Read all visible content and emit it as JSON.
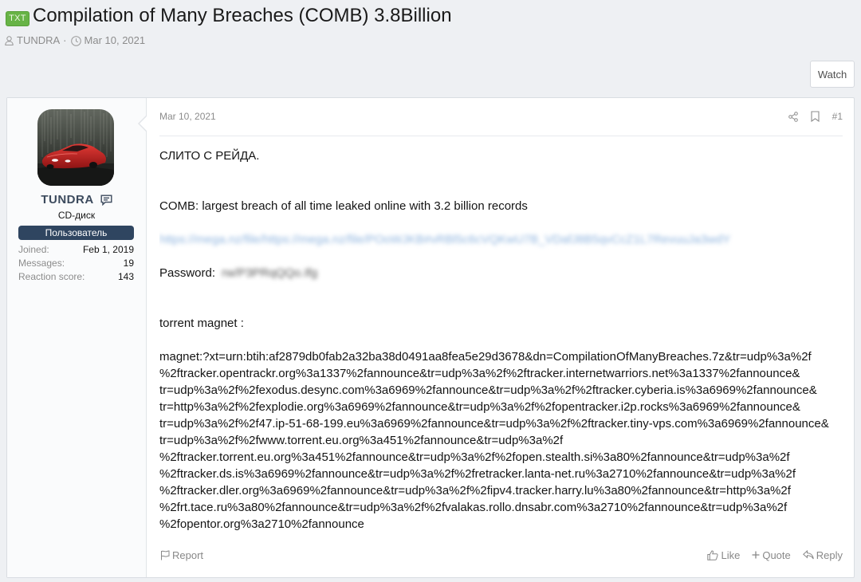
{
  "thread": {
    "prefix": "TXT",
    "title": "Compilation of Many Breaches (COMB) 3.8Billion",
    "author": "TUNDRA",
    "separator": "·",
    "date": "Mar 10, 2021",
    "watch_label": "Watch"
  },
  "user": {
    "name": "TUNDRA",
    "title": "CD-диск",
    "banner": "Пользователь",
    "stats": [
      {
        "label": "Joined:",
        "value": "Feb 1, 2019"
      },
      {
        "label": "Messages:",
        "value": "19"
      },
      {
        "label": "Reaction score:",
        "value": "143"
      }
    ]
  },
  "post": {
    "date": "Mar 10, 2021",
    "number": "#1",
    "body": {
      "line1": "СЛИТО С РЕЙДА.",
      "line2": "COMB: largest breach of all time leaked online with 3.2 billion records",
      "link_blurred": "https://mega.nz/file/https://mega.nz/file/POoWJKB#vRBl5c6cVQKwU7B_VDafJ8B5qvCcZ1L7RevuuJa3wdY",
      "password_label": "Password:",
      "password_blurred": "rw/P3PRqQQo.Ifg",
      "magnet_label": "torrent magnet :",
      "magnet_lines": [
        "magnet:?xt=urn:btih:af2879db0fab2a32ba38d0491aa8fea5e29d3678&dn=CompilationOfManyBreaches.7z&tr=udp%3a%2f",
        "%2ftracker.opentrackr.org%3a1337%2fannounce&tr=udp%3a%2f%2ftracker.internetwarriors.net%3a1337%2fannounce&",
        "tr=udp%3a%2f%2fexodus.desync.com%3a6969%2fannounce&tr=udp%3a%2f%2ftracker.cyberia.is%3a6969%2fannounce&",
        "tr=http%3a%2f%2fexplodie.org%3a6969%2fannounce&tr=udp%3a%2f%2fopentracker.i2p.rocks%3a6969%2fannounce&",
        "tr=udp%3a%2f%2f47.ip-51-68-199.eu%3a6969%2fannounce&tr=udp%3a%2f%2ftracker.tiny-vps.com%3a6969%2fannounce&",
        "tr=udp%3a%2f%2fwww.torrent.eu.org%3a451%2fannounce&tr=udp%3a%2f",
        "%2ftracker.torrent.eu.org%3a451%2fannounce&tr=udp%3a%2f%2fopen.stealth.si%3a80%2fannounce&tr=udp%3a%2f",
        "%2ftracker.ds.is%3a6969%2fannounce&tr=udp%3a%2f%2fretracker.lanta-net.ru%3a2710%2fannounce&tr=udp%3a%2f",
        "%2ftracker.dler.org%3a6969%2fannounce&tr=udp%3a%2f%2fipv4.tracker.harry.lu%3a80%2fannounce&tr=http%3a%2f",
        "%2frt.tace.ru%3a80%2fannounce&tr=udp%3a%2f%2fvalakas.rollo.dnsabr.com%3a2710%2fannounce&tr=udp%3a%2f",
        "%2fopentor.org%3a2710%2fannounce"
      ]
    },
    "actions": {
      "report": "Report",
      "like": "Like",
      "quote": "Quote",
      "reply": "Reply"
    }
  },
  "icons": {
    "author": "user-icon",
    "date": "clock-icon",
    "username_badge": "message-icon",
    "share": "share-icon",
    "bookmark": "bookmark-icon",
    "report": "flag-icon",
    "like": "thumbs-up-icon",
    "quote": "plus-icon",
    "reply": "reply-icon"
  },
  "colors": {
    "page_bg": "#eef0f3",
    "prefix_bg": "#67b346",
    "banner_bg": "#2f4560",
    "username": "#3c4a5d",
    "link": "#8db3de"
  }
}
